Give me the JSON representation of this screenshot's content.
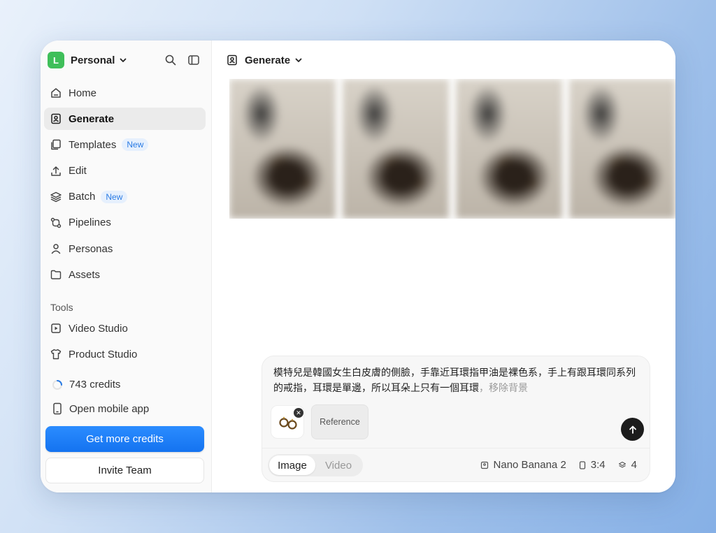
{
  "workspace": {
    "initial": "L",
    "name": "Personal",
    "avatar_color": "#3fbf5a"
  },
  "sidebar": {
    "items": [
      {
        "label": "Home",
        "icon": "home-icon"
      },
      {
        "label": "Generate",
        "icon": "generate-icon",
        "active": true
      },
      {
        "label": "Templates",
        "icon": "templates-icon",
        "badge": "New"
      },
      {
        "label": "Edit",
        "icon": "upload-icon"
      },
      {
        "label": "Batch",
        "icon": "layers-icon",
        "badge": "New"
      },
      {
        "label": "Pipelines",
        "icon": "pipelines-icon"
      },
      {
        "label": "Personas",
        "icon": "person-icon"
      },
      {
        "label": "Assets",
        "icon": "folder-icon"
      }
    ],
    "tools_label": "Tools",
    "tools": [
      {
        "label": "Video Studio",
        "icon": "video-icon"
      },
      {
        "label": "Product Studio",
        "icon": "shirt-icon"
      }
    ],
    "credits": "743 credits",
    "mobile": "Open mobile app",
    "get_credits": "Get more credits",
    "invite": "Invite Team"
  },
  "main": {
    "header_title": "Generate",
    "composer": {
      "prompt_text": "模特兒是韓國女生白皮膚的側臉，手靠近耳環指甲油是裸色系，手上有跟耳環同系列的戒指，耳環是單邊，所以耳朵上只有一個耳環",
      "prompt_tail": "，移除背景",
      "reference_label": "Reference",
      "modes": [
        "Image",
        "Video"
      ],
      "active_mode": "Image",
      "model": "Nano Banana 2",
      "aspect": "3:4",
      "count": "4"
    }
  },
  "colors": {
    "primary": "#1473f0",
    "badge_bg": "#e6f0fd",
    "badge_text": "#2a7be4"
  }
}
